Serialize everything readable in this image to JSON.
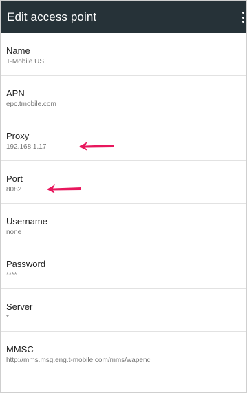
{
  "appbar": {
    "title": "Edit access point",
    "menu_icon": "overflow-menu-icon"
  },
  "fields": [
    {
      "label": "Name",
      "value": "T-Mobile US"
    },
    {
      "label": "APN",
      "value": "epc.tmobile.com"
    },
    {
      "label": "Proxy",
      "value": "192.168.1.17"
    },
    {
      "label": "Port",
      "value": "8082"
    },
    {
      "label": "Username",
      "value": "none"
    },
    {
      "label": "Password",
      "value": "****"
    },
    {
      "label": "Server",
      "value": "*"
    },
    {
      "label": "MMSC",
      "value": "http://mms.msg.eng.t-mobile.com/mms/wapenc"
    }
  ],
  "annotations": {
    "arrow_color": "#e8175d",
    "arrow_icon": "left-arrow-icon"
  },
  "colors": {
    "appbar": "#263238",
    "title_text": "#212121",
    "summary_text": "#757575"
  }
}
